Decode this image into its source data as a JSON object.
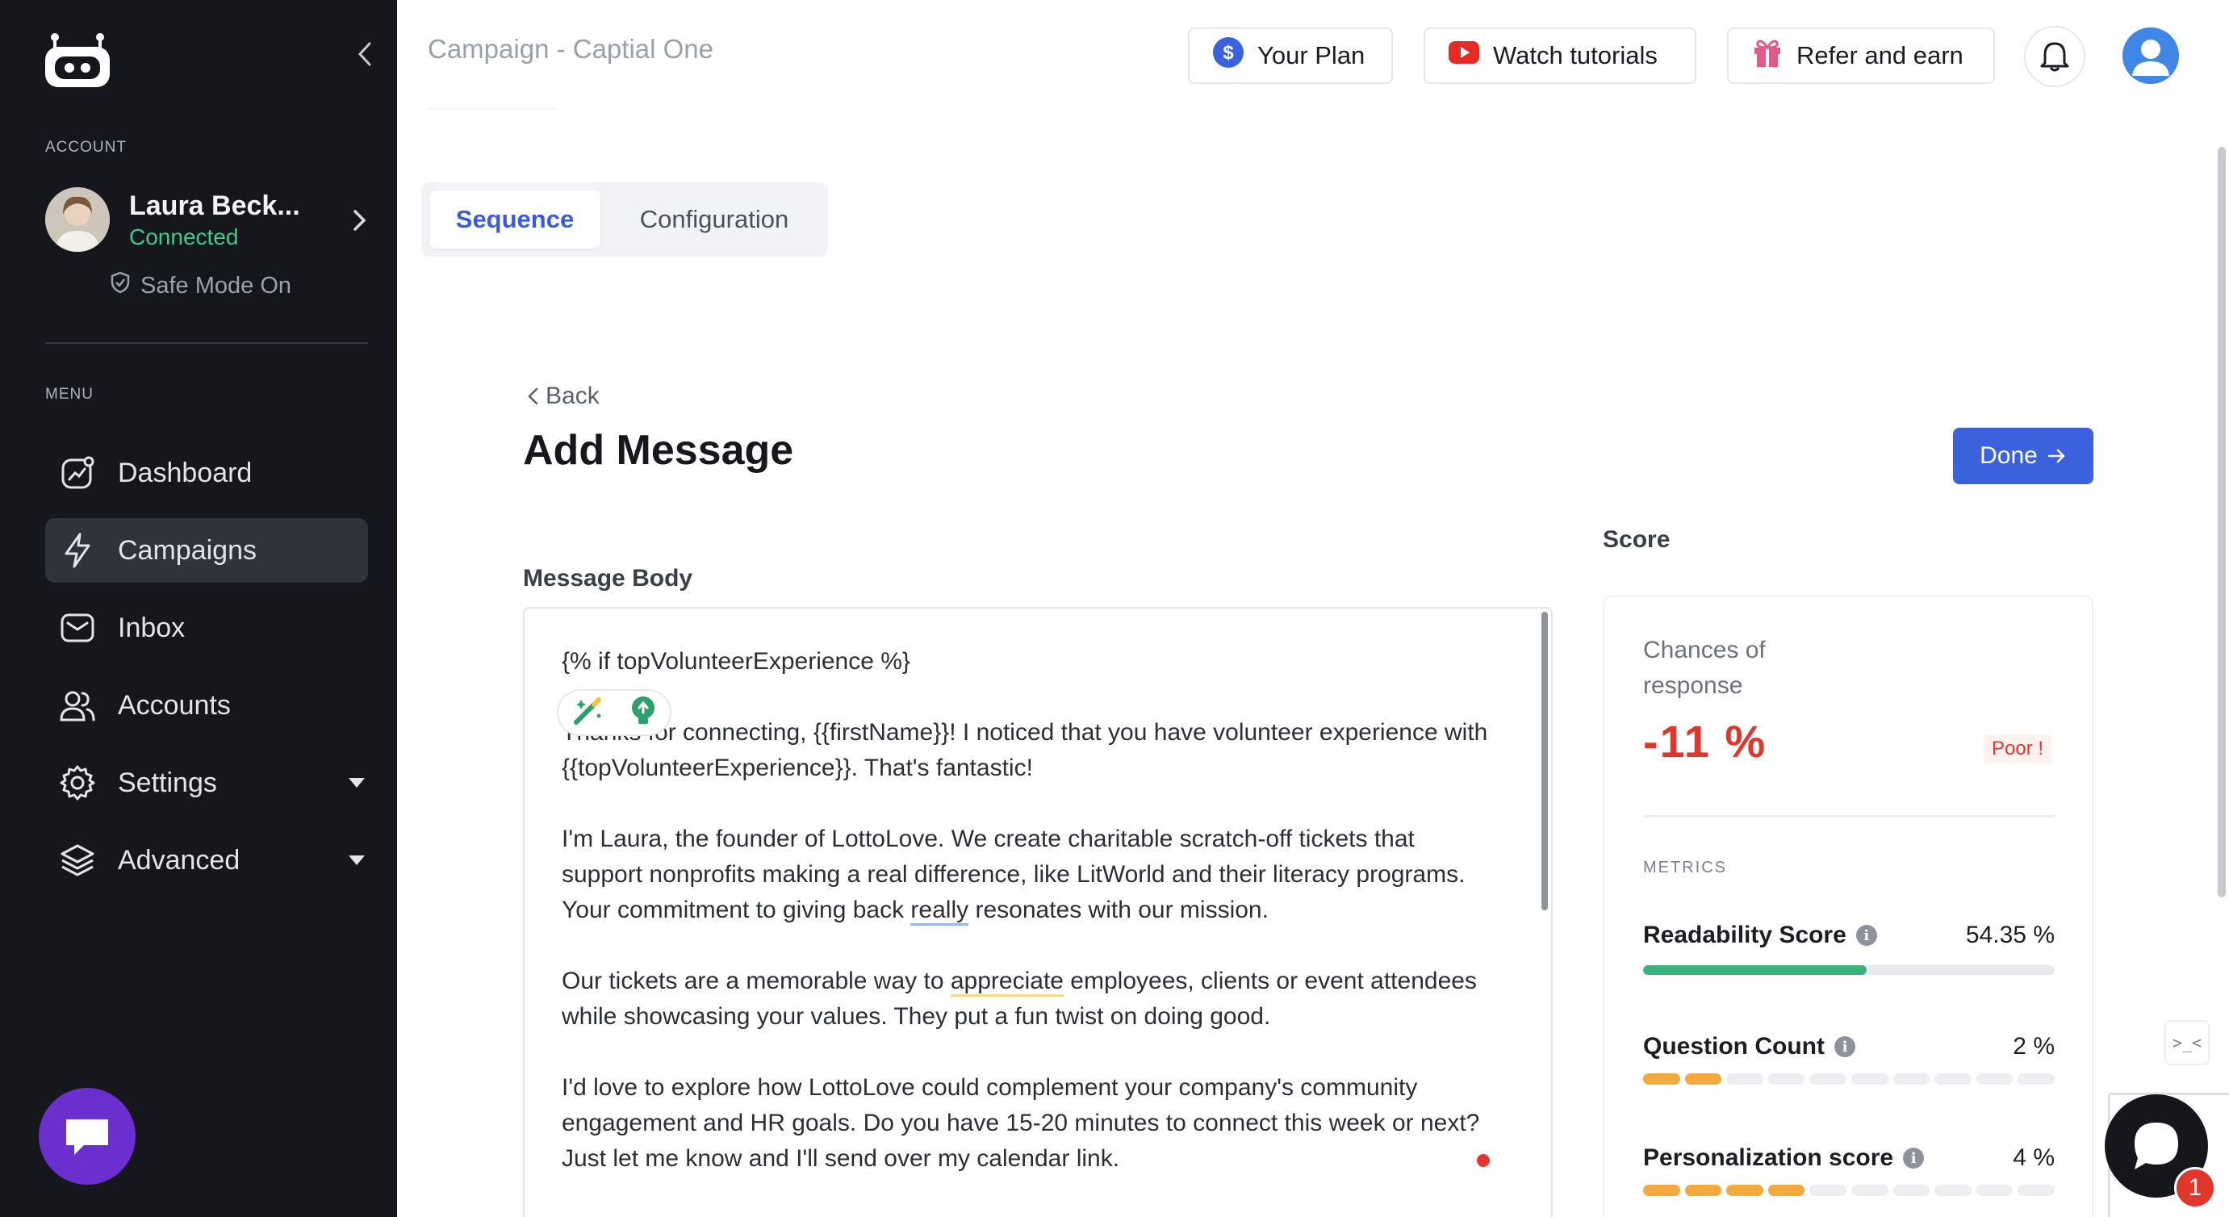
{
  "sidebar": {
    "account_section_label": "ACCOUNT",
    "account": {
      "name": "Laura Beck...",
      "status": "Connected"
    },
    "safe_mode": "Safe Mode On",
    "menu_section_label": "MENU",
    "items": [
      {
        "label": "Dashboard",
        "icon": "dashboard-icon"
      },
      {
        "label": "Campaigns",
        "icon": "lightning-icon",
        "active": true
      },
      {
        "label": "Inbox",
        "icon": "inbox-icon"
      },
      {
        "label": "Accounts",
        "icon": "users-icon"
      },
      {
        "label": "Settings",
        "icon": "gear-icon",
        "dropdown": true
      },
      {
        "label": "Advanced",
        "icon": "layers-icon",
        "dropdown": true
      }
    ]
  },
  "header": {
    "title": "Campaign - Captial One",
    "buttons": {
      "plan": "Your Plan",
      "tutorials": "Watch tutorials",
      "refer": "Refer and earn"
    }
  },
  "tabs": [
    {
      "label": "Sequence",
      "active": true
    },
    {
      "label": "Configuration",
      "active": false
    }
  ],
  "editor_page": {
    "back_label": "Back",
    "title": "Add Message",
    "done_label": "Done",
    "message_body_label": "Message Body",
    "message": {
      "line1": "{% if topVolunteerExperience %}",
      "para1": "Thanks for connecting, {{firstName}}! I noticed that you have volunteer experience with {{topVolunteerExperience}}. That's fantastic!",
      "para2_before": "I'm Laura, the founder of LottoLove. We create charitable scratch-off tickets that support nonprofits making a real difference, like LitWorld and their literacy programs. Your commitment to giving back ",
      "para2_underlined": "really",
      "para2_after": " resonates with our mission.",
      "para3_before": "Our tickets are a memorable way to ",
      "para3_underlined": "appreciate",
      "para3_after": " employees, clients or event attendees while showcasing your values. They put a fun twist on doing good.",
      "para4": "I'd love to explore how LottoLove could complement your company's community engagement and HR goals. Do you have 15-20 minutes to connect this week or next? Just let me know and I'll send over my calendar link."
    }
  },
  "score": {
    "section_label": "Score",
    "chances_label": "Chances of response",
    "chances_value": "-11 %",
    "rating": "Poor !",
    "metrics_label": "METRICS",
    "metrics": [
      {
        "name": "Readability Score",
        "value": "54.35 %",
        "fraction": 0.5435,
        "type": "bar"
      },
      {
        "name": "Question Count",
        "value": "2 %",
        "segments_on": 2,
        "segments_total": 10,
        "type": "segments"
      },
      {
        "name": "Personalization score",
        "value": "4 %",
        "segments_on": 4,
        "segments_total": 10,
        "type": "segments"
      }
    ]
  },
  "widgets": {
    "support_badge_count": "1",
    "side_mini": ">_<"
  },
  "colors": {
    "sidebar_bg": "#15171c",
    "accent": "#3b62dc",
    "connected": "#3fcc8a",
    "danger": "#e0372c",
    "metric_bar": "#3ab37a",
    "metric_segment": "#f3a93b",
    "chat_fab": "#6b2fd0"
  }
}
